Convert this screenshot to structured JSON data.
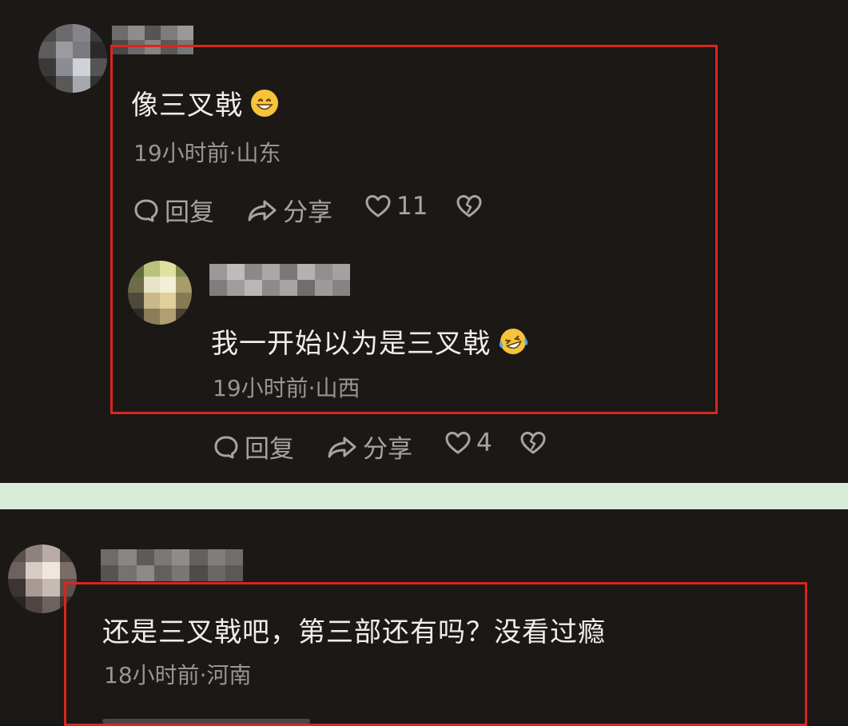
{
  "comments": [
    {
      "text": "像三叉戟",
      "emoji": "grinning-face-emoji",
      "meta": "19小时前·山东",
      "actions": {
        "reply": "回复",
        "share": "分享",
        "likes": "11"
      },
      "replies": [
        {
          "text": "我一开始以为是三叉戟",
          "emoji": "laughing-tears-emoji",
          "meta": "19小时前·山西",
          "actions": {
            "reply": "回复",
            "share": "分享",
            "likes": "4"
          }
        }
      ]
    },
    {
      "text": "还是三叉戟吧，第三部还有吗？没看过瘾",
      "meta": "18小时前·河南"
    }
  ],
  "colors": {
    "highlight_box": "#d9261f",
    "divider": "#d6ecd7",
    "background": "#1b1816"
  }
}
